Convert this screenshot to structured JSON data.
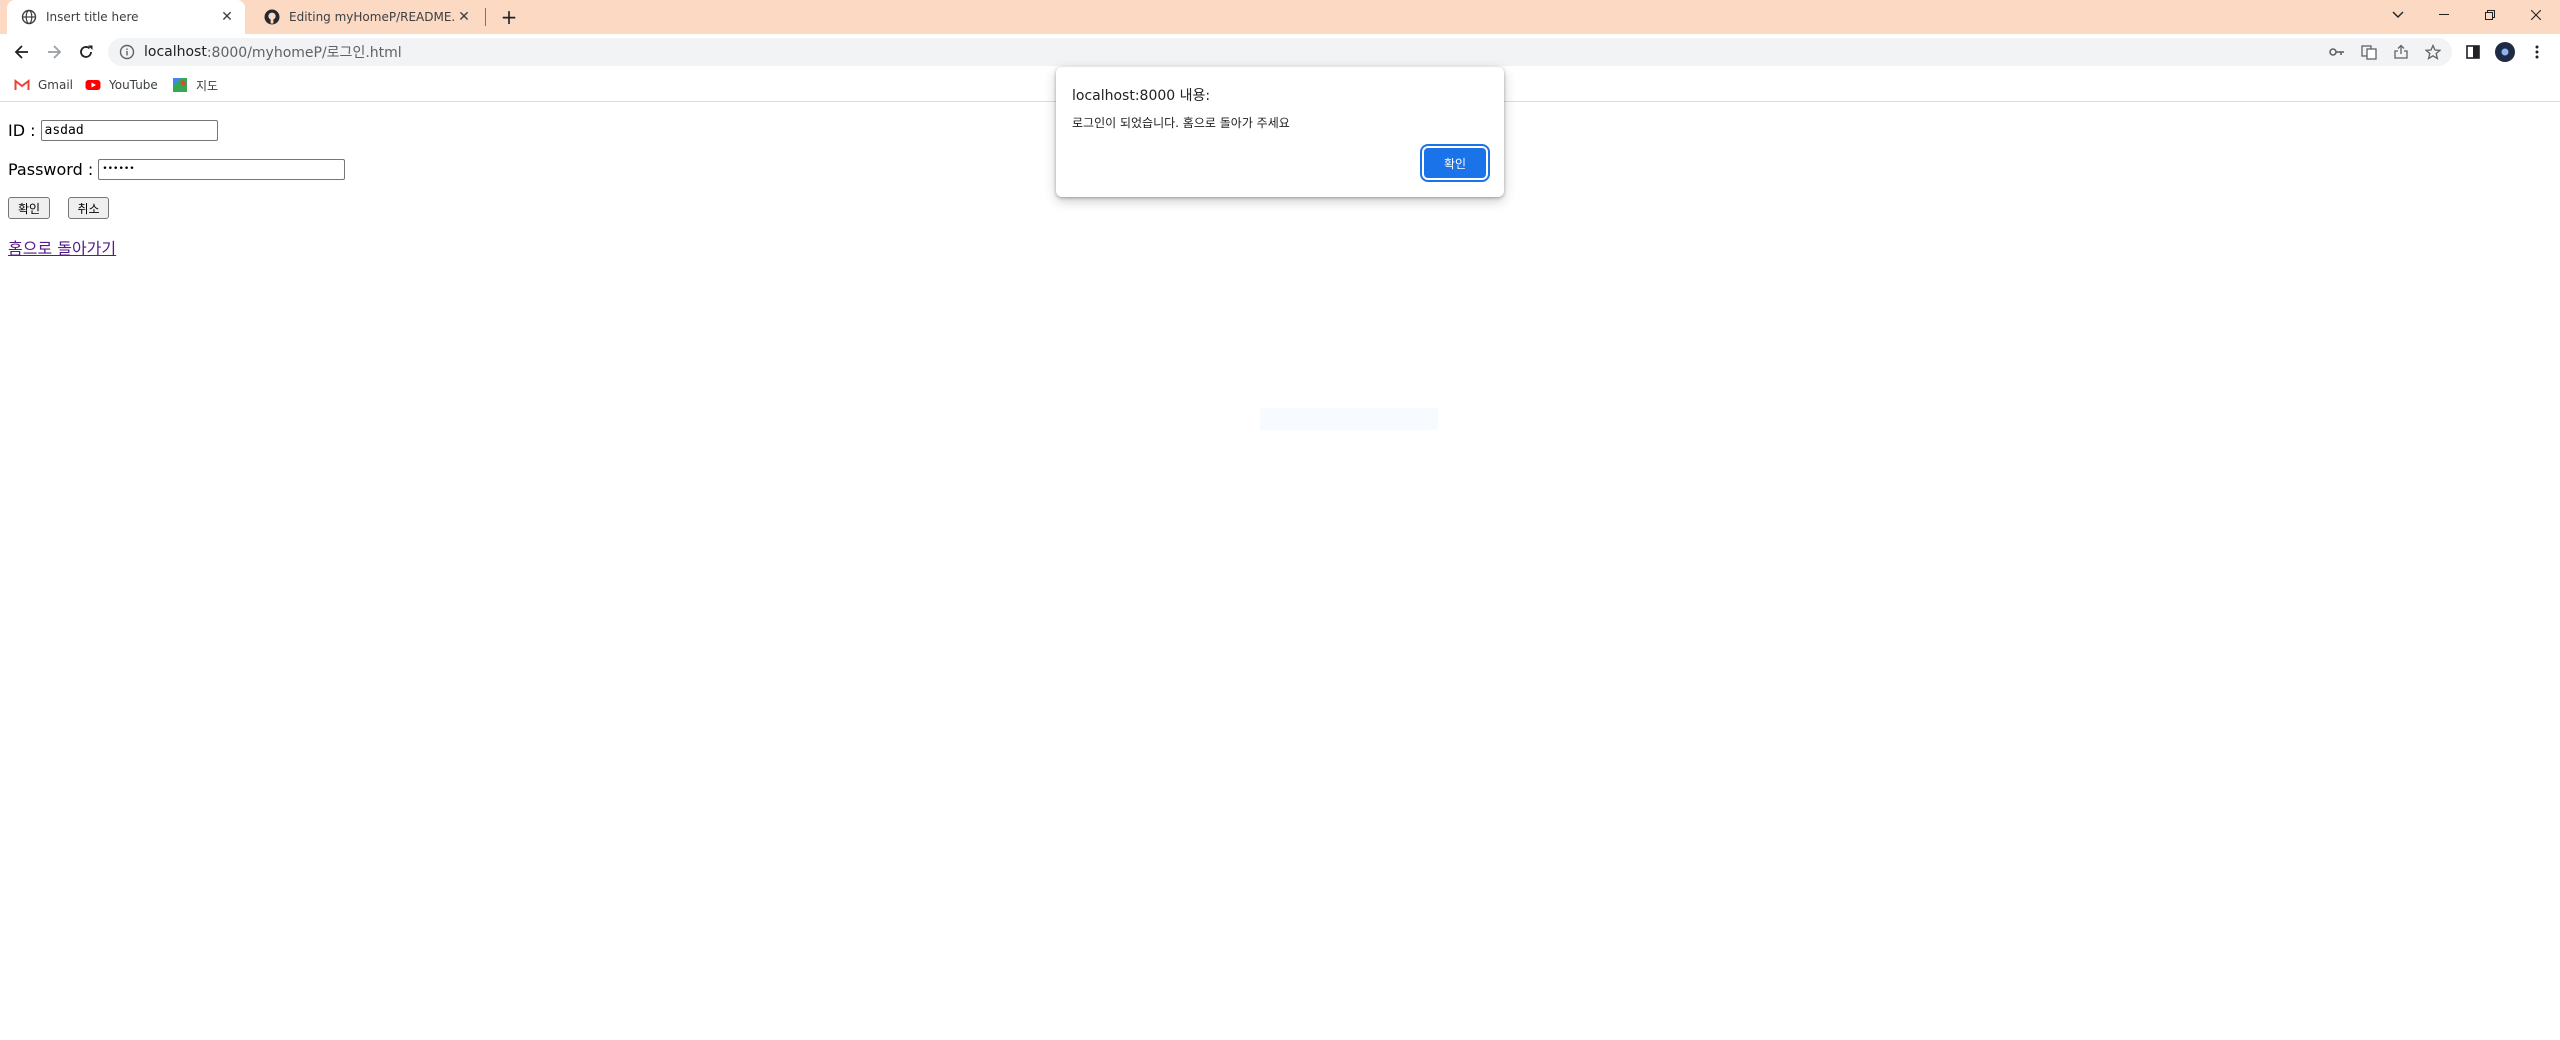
{
  "tabs": [
    {
      "title": "Insert title here",
      "icon": "globe-icon"
    },
    {
      "title": "Editing myHomeP/README.md",
      "icon": "github-icon"
    }
  ],
  "address_bar": {
    "host": "localhost",
    "path": ":8000/myhomeP/로그인.html"
  },
  "bookmarks": [
    {
      "label": "Gmail",
      "icon": "gmail-icon"
    },
    {
      "label": "YouTube",
      "icon": "youtube-icon"
    },
    {
      "label": "지도",
      "icon": "maps-icon"
    }
  ],
  "form": {
    "id_label": "ID :",
    "id_value": "asdad",
    "password_label": "Password :",
    "password_value": "••••••",
    "confirm_button": "확인",
    "cancel_button": "취소",
    "home_link": "홈으로 돌아가기"
  },
  "dialog": {
    "title": "localhost:8000 내용:",
    "message": "로그인이 되었습니다. 홈으로 돌아가 주세요",
    "ok_button": "확인"
  },
  "colors": {
    "tabstrip": "#fcd9c3",
    "accent": "#1a73e8",
    "link": "#551a8b"
  }
}
